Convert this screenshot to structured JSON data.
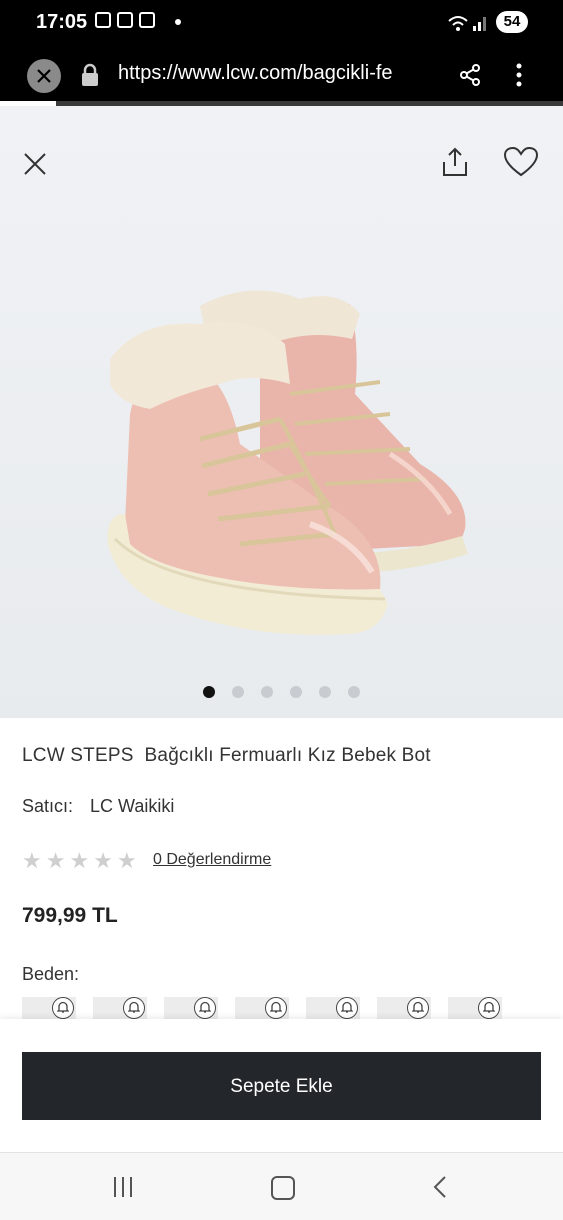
{
  "status_bar": {
    "time": "17:05",
    "battery": "54"
  },
  "browser": {
    "url": "https://www.lcw.com/bagcikli-fe"
  },
  "gallery": {
    "image_count": 6,
    "active_index": 0
  },
  "product": {
    "title": "LCW STEPS  Bağcıklı Fermuarlı Kız Bebek Bot",
    "seller_label": "Satıcı:",
    "seller_name": "LC Waikiki",
    "rating_stars": 0,
    "reviews_link": "0 Değerlendirme",
    "price": "799,99 TL",
    "size_label": "Beden:"
  },
  "cart": {
    "add_button": "Sepete Ekle"
  },
  "colors": {
    "button_bg": "#23272b",
    "star_empty": "#cfcfcf",
    "dot_active": "#111111",
    "dot_inactive": "#c8cbcf"
  },
  "icons": [
    "close-icon",
    "lock-icon",
    "share-icon",
    "more-vert-icon",
    "upload-share-icon",
    "heart-icon",
    "star-icon",
    "bell-icon",
    "recent-apps-icon",
    "home-icon",
    "back-icon"
  ]
}
